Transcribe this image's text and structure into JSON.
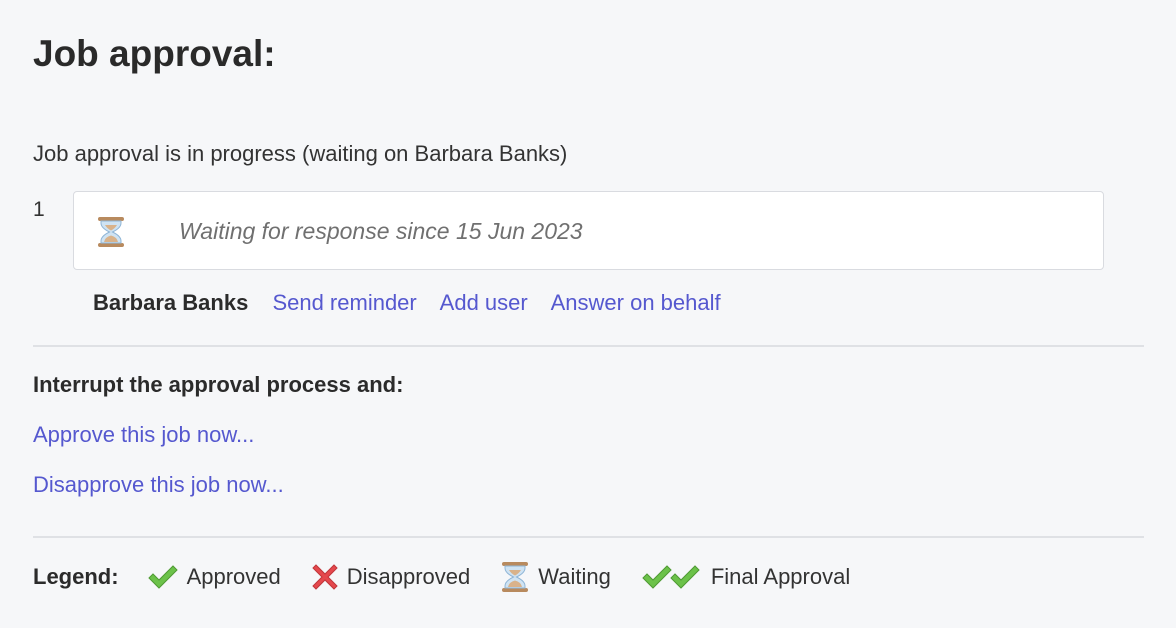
{
  "page": {
    "title": "Job approval:"
  },
  "status": {
    "text": "Job approval is in progress (waiting on Barbara Banks)"
  },
  "steps": [
    {
      "number": "1",
      "status_icon": "hourglass-icon",
      "status_text": "Waiting for response since 15 Jun 2023",
      "approver": "Barbara Banks",
      "actions": {
        "send_reminder": "Send reminder",
        "add_user": "Add user",
        "answer_on_behalf": "Answer on behalf"
      }
    }
  ],
  "interrupt": {
    "heading": "Interrupt the approval process and:",
    "approve_link": "Approve this job now...",
    "disapprove_link": "Disapprove this job now..."
  },
  "legend": {
    "label": "Legend:",
    "items": [
      {
        "icon": "check-icon",
        "label": "Approved"
      },
      {
        "icon": "cross-icon",
        "label": "Disapproved"
      },
      {
        "icon": "hourglass-icon",
        "label": "Waiting"
      },
      {
        "icon": "double-check-icon",
        "label": "Final Approval"
      }
    ]
  },
  "colors": {
    "background": "#f6f7f9",
    "link": "#5558cf",
    "approved_green": "#6cc24a",
    "disapproved_red": "#e5484d",
    "hourglass_sand": "#c8a27a",
    "hourglass_glass": "#9ec7e8"
  }
}
